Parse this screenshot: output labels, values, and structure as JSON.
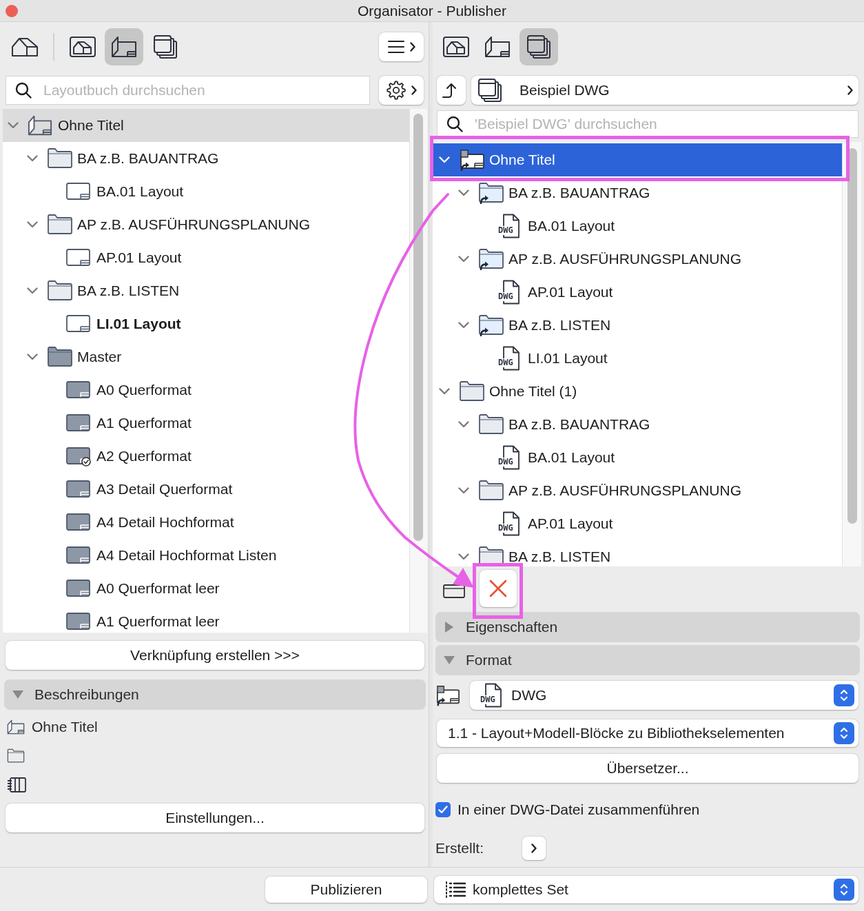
{
  "window": {
    "title": "Organisator - Publisher"
  },
  "left_panel": {
    "toolbar": [
      {
        "kind": "house",
        "selected": false
      },
      {
        "kind": "frame",
        "selected": false
      },
      {
        "kind": "book",
        "selected": true
      },
      {
        "kind": "stack",
        "selected": false
      }
    ],
    "search": {
      "placeholder": "Layoutbuch durchsuchen"
    },
    "tree": [
      {
        "label": "Ohne Titel",
        "kind": "book",
        "selected": true,
        "expanded": true,
        "children": [
          {
            "label": "BA z.B. BAUANTRAG",
            "kind": "folder",
            "selected": false,
            "expanded": true,
            "children": [
              {
                "label": "BA.01 Layout",
                "kind": "layout",
                "selected": false,
                "bold": false
              }
            ]
          },
          {
            "label": "AP z.B. AUSFÜHRUNGSPLANUNG",
            "kind": "folder",
            "selected": false,
            "expanded": true,
            "children": [
              {
                "label": "AP.01 Layout",
                "kind": "layout",
                "selected": false,
                "bold": false
              }
            ]
          },
          {
            "label": "BA z.B. LISTEN",
            "kind": "folder",
            "selected": false,
            "expanded": true,
            "children": [
              {
                "label": "LI.01 Layout",
                "kind": "layout",
                "selected": false,
                "bold": true
              }
            ]
          },
          {
            "label": "Master",
            "kind": "master_folder",
            "selected": false,
            "expanded": true,
            "children": [
              {
                "label": "A0 Querformat",
                "kind": "master_layout",
                "selected": false,
                "bold": false,
                "check_badge": false
              },
              {
                "label": "A1 Querformat",
                "kind": "master_layout",
                "selected": false,
                "bold": false,
                "check_badge": false
              },
              {
                "label": "A2 Querformat",
                "kind": "master_layout",
                "selected": false,
                "bold": false,
                "check_badge": true
              },
              {
                "label": "A3 Detail Querformat",
                "kind": "master_layout",
                "selected": false,
                "bold": false,
                "check_badge": false
              },
              {
                "label": "A4 Detail Hochformat",
                "kind": "master_layout",
                "selected": false,
                "bold": false,
                "check_badge": false
              },
              {
                "label": "A4 Detail Hochformat Listen",
                "kind": "master_layout",
                "selected": false,
                "bold": false,
                "check_badge": false
              },
              {
                "label": "A0 Querformat leer",
                "kind": "master_layout",
                "selected": false,
                "bold": false,
                "check_badge": false
              },
              {
                "label": "A1 Querformat leer",
                "kind": "master_layout",
                "selected": false,
                "bold": false,
                "check_badge": false
              }
            ]
          }
        ]
      }
    ],
    "link_button": "Verknüpfung erstellen >>>",
    "descriptions": {
      "title": "Beschreibungen",
      "expanded": true,
      "rows": [
        {
          "kind": "book",
          "text": "Ohne Titel"
        },
        {
          "kind": "folder"
        },
        {
          "kind": "binder"
        }
      ]
    },
    "settings_button": "Einstellungen..."
  },
  "right_panel": {
    "toolbar": [
      {
        "kind": "frame",
        "selected": false
      },
      {
        "kind": "book",
        "selected": false
      },
      {
        "kind": "stack",
        "selected": true
      }
    ],
    "set_button": "Beispiel DWG",
    "search": {
      "placeholder": "'Beispiel DWG' durchsuchen"
    },
    "tree": [
      {
        "label": "Ohne Titel",
        "kind": "linked_book",
        "selected": true,
        "expanded": true,
        "children": [
          {
            "label": "BA z.B. BAUANTRAG",
            "kind": "linked_folder",
            "selected": false,
            "expanded": true,
            "children": [
              {
                "label": "BA.01 Layout",
                "kind": "file",
                "file_type": "DWG",
                "selected": false
              }
            ]
          },
          {
            "label": "AP z.B. AUSFÜHRUNGSPLANUNG",
            "kind": "linked_folder",
            "selected": false,
            "expanded": true,
            "children": [
              {
                "label": "AP.01 Layout",
                "kind": "file",
                "file_type": "DWG",
                "selected": false
              }
            ]
          },
          {
            "label": "BA z.B. LISTEN",
            "kind": "linked_folder",
            "selected": false,
            "expanded": true,
            "children": [
              {
                "label": "LI.01 Layout",
                "kind": "file",
                "file_type": "DWG",
                "selected": false
              }
            ]
          }
        ]
      },
      {
        "label": "Ohne Titel (1)",
        "kind": "folder",
        "selected": false,
        "expanded": true,
        "children": [
          {
            "label": "BA z.B. BAUANTRAG",
            "kind": "folder",
            "selected": false,
            "expanded": true,
            "children": [
              {
                "label": "BA.01 Layout",
                "kind": "file",
                "file_type": "DWG",
                "selected": false
              }
            ]
          },
          {
            "label": "AP z.B. AUSFÜHRUNGSPLANUNG",
            "kind": "folder",
            "selected": false,
            "expanded": true,
            "children": [
              {
                "label": "AP.01 Layout",
                "kind": "file",
                "file_type": "DWG",
                "selected": false
              }
            ]
          },
          {
            "label": "BA z.B. LISTEN",
            "kind": "folder",
            "selected": false,
            "expanded": true
          }
        ]
      }
    ],
    "sections": [
      {
        "title": "Eigenschaften",
        "expanded": false
      },
      {
        "title": "Format",
        "expanded": true,
        "content": {
          "file_type": {
            "icon_label": "DWG",
            "value": "DWG"
          },
          "option": "1.1 - Layout+Modell-Blöcke zu Bibliothekselementen",
          "translator_button": "Übersetzer...",
          "merge": {
            "label": "In einer DWG-Datei zusammenführen",
            "checked": true
          },
          "created_label": "Erstellt:"
        }
      }
    ]
  },
  "footer": {
    "publish_button": "Publizieren",
    "set_select": "komplettes Set"
  }
}
